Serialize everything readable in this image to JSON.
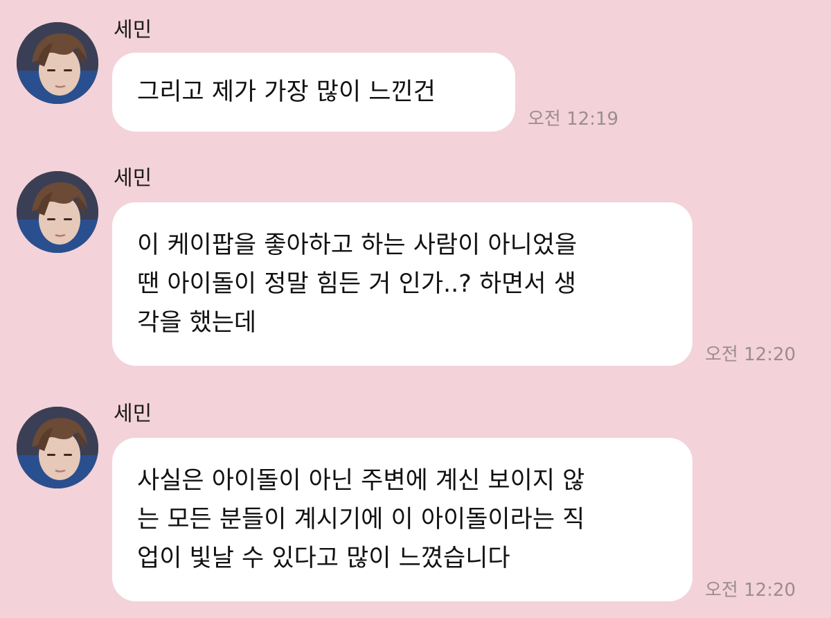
{
  "messages": [
    {
      "sender": "세민",
      "avatar": "profile-photo",
      "lines": [
        "그리고 제가 가장 많이 느낀건"
      ],
      "time": "오전 12:19"
    },
    {
      "sender": "세민",
      "avatar": "profile-photo",
      "lines": [
        "이 케이팝을 좋아하고 하는 사람이 아니었을",
        "땐 아이돌이 정말 힘든 거 인가..? 하면서 생",
        "각을 했는데"
      ],
      "time": "오전 12:20"
    },
    {
      "sender": "세민",
      "avatar": "profile-photo",
      "lines": [
        "사실은 아이돌이 아닌 주변에 계신 보이지 않",
        "는 모든 분들이 계시기에 이 아이돌이라는 직",
        "업이 빛날 수 있다고 많이 느꼈습니다"
      ],
      "time": "오전 12:20"
    }
  ],
  "colors": {
    "background": "#f3d2d9",
    "bubble": "#ffffff",
    "timestamp": "#9b8c91"
  }
}
